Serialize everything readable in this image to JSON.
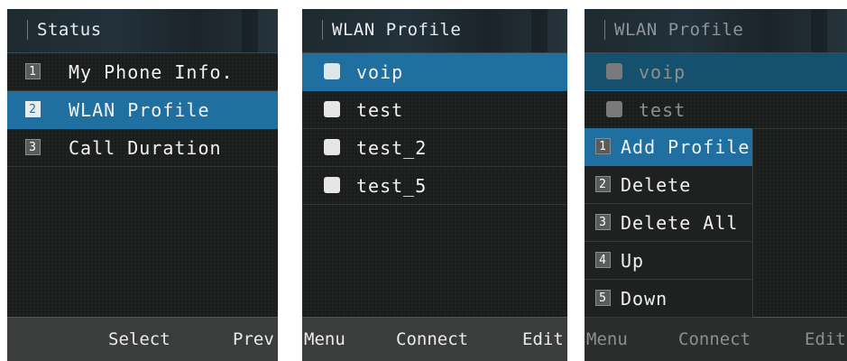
{
  "screens": [
    {
      "title": "Status",
      "items": [
        {
          "num": "1",
          "label": "My Phone Info."
        },
        {
          "num": "2",
          "label": "WLAN Profile"
        },
        {
          "num": "3",
          "label": "Call Duration"
        }
      ],
      "softkeys": {
        "center": "Select",
        "right": "Prev"
      }
    },
    {
      "title": "WLAN Profile",
      "items": [
        "voip",
        "test",
        "test_2",
        "test_5"
      ],
      "softkeys": {
        "left": "Menu",
        "center": "Connect",
        "right": "Edit"
      }
    },
    {
      "title": "WLAN Profile",
      "items": [
        "voip",
        "test"
      ],
      "menu": [
        {
          "num": "1",
          "label": "Add Profile"
        },
        {
          "num": "2",
          "label": "Delete"
        },
        {
          "num": "3",
          "label": "Delete All"
        },
        {
          "num": "4",
          "label": "Up"
        },
        {
          "num": "5",
          "label": "Down"
        }
      ],
      "softkeys": {
        "left": "Menu",
        "center": "Connect",
        "right": "Edit"
      }
    }
  ],
  "colors": {
    "highlight": "#1f6fa0",
    "background": "#1c1e1d",
    "softbar": "#3a3d3b"
  }
}
